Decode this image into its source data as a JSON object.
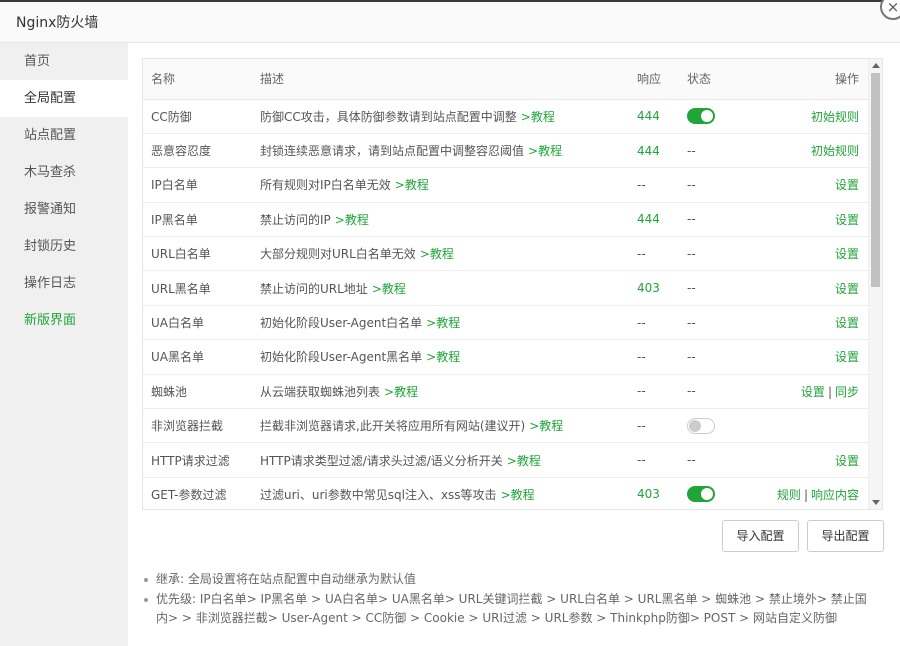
{
  "window": {
    "title": "Nginx防火墙",
    "close_glyph": "×"
  },
  "sidebar": {
    "items": [
      {
        "label": "首页"
      },
      {
        "label": "全局配置"
      },
      {
        "label": "站点配置"
      },
      {
        "label": "木马查杀"
      },
      {
        "label": "报警通知"
      },
      {
        "label": "封锁历史"
      },
      {
        "label": "操作日志"
      },
      {
        "label": "新版界面"
      }
    ],
    "active_index": 1
  },
  "table": {
    "headers": {
      "name": "名称",
      "desc": "描述",
      "resp": "响应",
      "state": "状态",
      "op": "操作"
    },
    "rows": [
      {
        "name": "CC防御",
        "desc": "防御CC攻击，具体防御参数请到站点配置中调整",
        "tutorial": ">教程",
        "resp": "444",
        "state": "on",
        "ops": [
          "初始规则"
        ]
      },
      {
        "name": "恶意容忍度",
        "desc": "封锁连续恶意请求，请到站点配置中调整容忍阈值",
        "tutorial": ">教程",
        "resp": "444",
        "state": "--",
        "ops": [
          "初始规则"
        ]
      },
      {
        "name": "IP白名单",
        "desc": "所有规则对IP白名单无效",
        "tutorial": ">教程",
        "resp": "--",
        "state": "--",
        "ops": [
          "设置"
        ]
      },
      {
        "name": "IP黑名单",
        "desc": "禁止访问的IP",
        "tutorial": ">教程",
        "resp": "444",
        "state": "--",
        "ops": [
          "设置"
        ]
      },
      {
        "name": "URL白名单",
        "desc": "大部分规则对URL白名单无效",
        "tutorial": ">教程",
        "resp": "--",
        "state": "--",
        "ops": [
          "设置"
        ]
      },
      {
        "name": "URL黑名单",
        "desc": "禁止访问的URL地址",
        "tutorial": ">教程",
        "resp": "403",
        "state": "--",
        "ops": [
          "设置"
        ]
      },
      {
        "name": "UA白名单",
        "desc": "初始化阶段User-Agent白名单",
        "tutorial": ">教程",
        "resp": "--",
        "state": "--",
        "ops": [
          "设置"
        ]
      },
      {
        "name": "UA黑名单",
        "desc": "初始化阶段User-Agent黑名单",
        "tutorial": ">教程",
        "resp": "--",
        "state": "--",
        "ops": [
          "设置"
        ]
      },
      {
        "name": "蜘蛛池",
        "desc": "从云端获取蜘蛛池列表",
        "tutorial": ">教程",
        "resp": "--",
        "state": "--",
        "ops": [
          "设置",
          "同步"
        ]
      },
      {
        "name": "非浏览器拦截",
        "desc": "拦截非浏览器请求,此开关将应用所有网站(建议开)",
        "tutorial": ">教程",
        "resp": "--",
        "state": "off",
        "ops": []
      },
      {
        "name": "HTTP请求过滤",
        "desc": "HTTP请求类型过滤/请求头过滤/语义分析开关",
        "tutorial": ">教程",
        "resp": "--",
        "state": "--",
        "ops": [
          "设置"
        ]
      },
      {
        "name": "GET-参数过滤",
        "desc": "过滤uri、uri参数中常见sql注入、xss等攻击",
        "tutorial": ">教程",
        "resp": "403",
        "state": "on",
        "ops": [
          "规则",
          "响应内容"
        ]
      }
    ]
  },
  "buttons": {
    "import": "导入配置",
    "export": "导出配置"
  },
  "notes": [
    "继承: 全局设置将在站点配置中自动继承为默认值",
    "优先级: IP白名单> IP黑名单 > UA白名单> UA黑名单> URL关键词拦截 > URL白名单 > URL黑名单 > 蜘蛛池 > 禁止境外> 禁止国内> > 非浏览器拦截> User-Agent > CC防御 > Cookie > URI过滤 > URL参数 > Thinkphp防御> POST > 网站自定义防御"
  ],
  "colors": {
    "accent": "#20a53a"
  }
}
